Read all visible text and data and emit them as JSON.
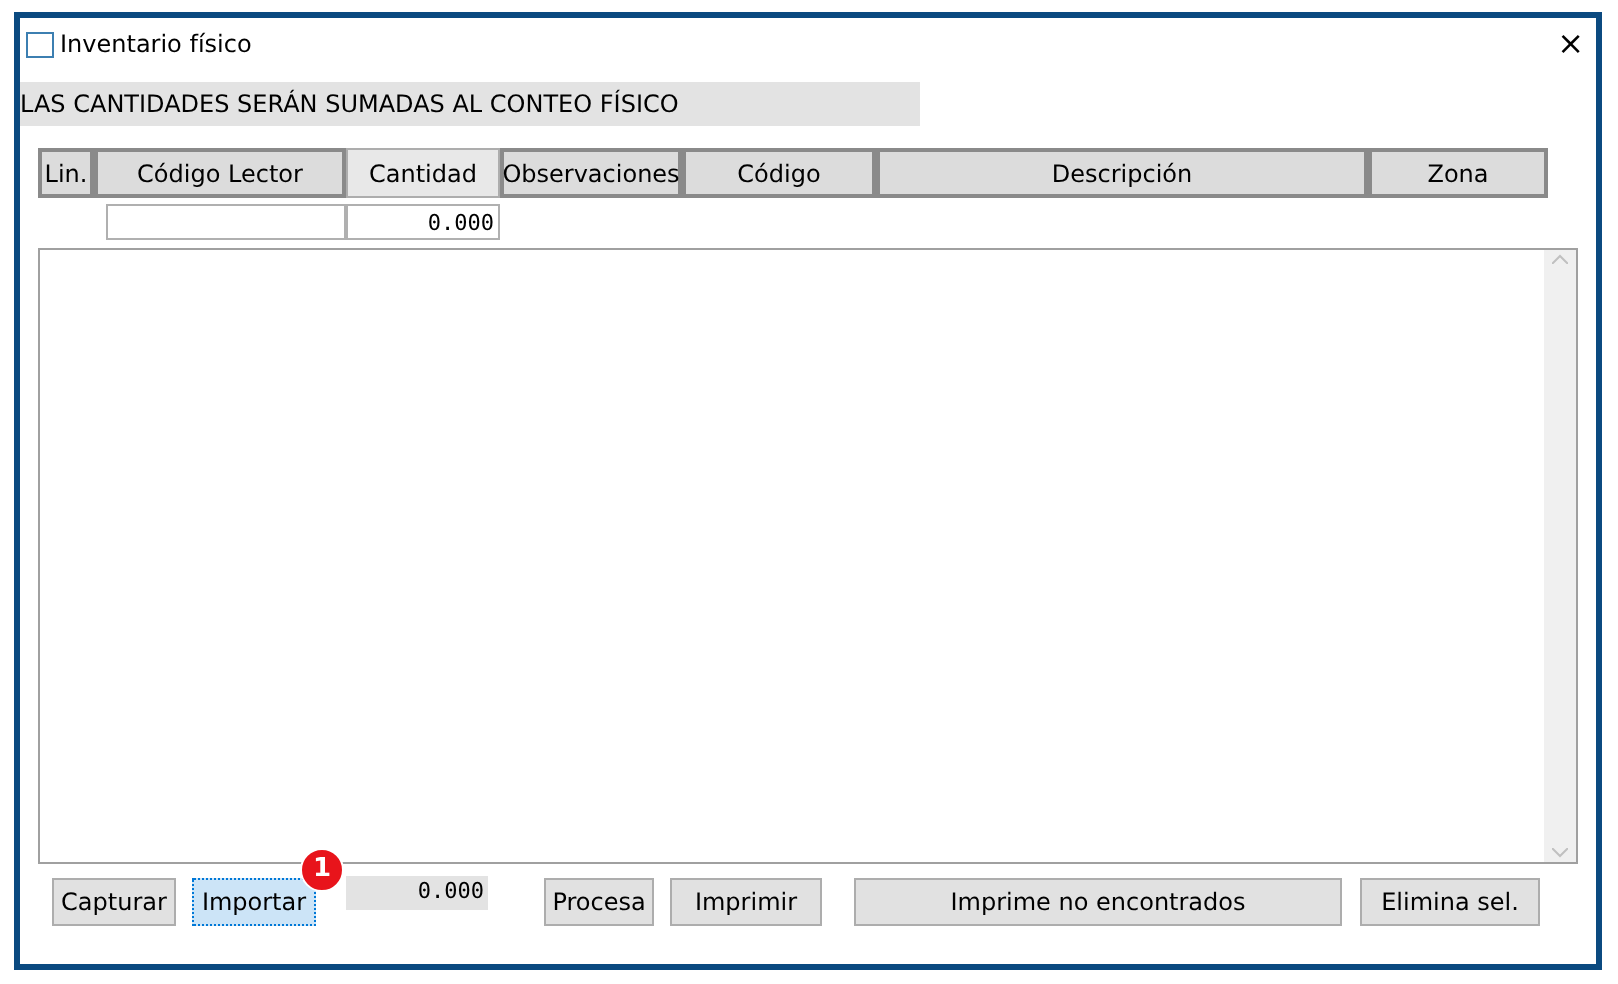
{
  "window": {
    "title": "Inventario físico",
    "close": "×"
  },
  "notice": "LAS CANTIDADES SERÁN SUMADAS AL CONTEO FÍSICO",
  "table": {
    "columns": [
      {
        "label": "Lin.",
        "selected": false
      },
      {
        "label": "Código Lector",
        "selected": false
      },
      {
        "label": "Cantidad",
        "selected": true
      },
      {
        "label": "Observaciones",
        "selected": false
      },
      {
        "label": "Código",
        "selected": false
      },
      {
        "label": "Descripción",
        "selected": false
      },
      {
        "label": "Zona",
        "selected": false
      }
    ],
    "entry": {
      "quantity": "0.000"
    }
  },
  "buttons": [
    {
      "label": "Capturar",
      "focused": false
    },
    {
      "label": "Importar",
      "focused": true,
      "badge": "1"
    }
  ],
  "total": "0.000",
  "buttons_right": [
    {
      "label": "Procesa",
      "focused": false
    },
    {
      "label": "Imprimir",
      "focused": false
    },
    {
      "label": "Imprime no encontrados",
      "focused": false
    },
    {
      "label": "Elimina sel.",
      "focused": false
    }
  ]
}
